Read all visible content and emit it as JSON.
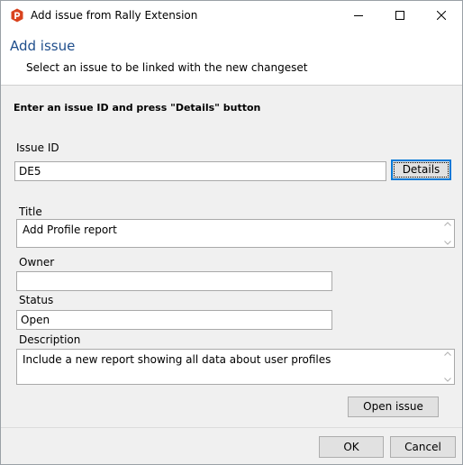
{
  "window": {
    "title": "Add issue from Rally Extension",
    "controls": [
      "minimize-icon",
      "maximize-icon",
      "close-icon"
    ]
  },
  "header": {
    "title": "Add issue",
    "subtitle": "Select an issue to be linked with the new changeset"
  },
  "form": {
    "instruction": "Enter an issue ID and press \"Details\" button",
    "issue_id_label": "Issue ID",
    "issue_id_value": "DE5",
    "details_button": "Details",
    "title_label": "Title",
    "title_value": "Add Profile report",
    "owner_label": "Owner",
    "owner_value": "",
    "status_label": "Status",
    "status_value": "Open",
    "description_label": "Description",
    "description_value": "Include a new report showing all data about user profiles",
    "open_issue_button": "Open issue"
  },
  "footer": {
    "ok_button": "OK",
    "cancel_button": "Cancel"
  },
  "colors": {
    "header_title": "#1f4e8c",
    "app_icon": "#d9431e",
    "focus_border": "#0078d7"
  }
}
